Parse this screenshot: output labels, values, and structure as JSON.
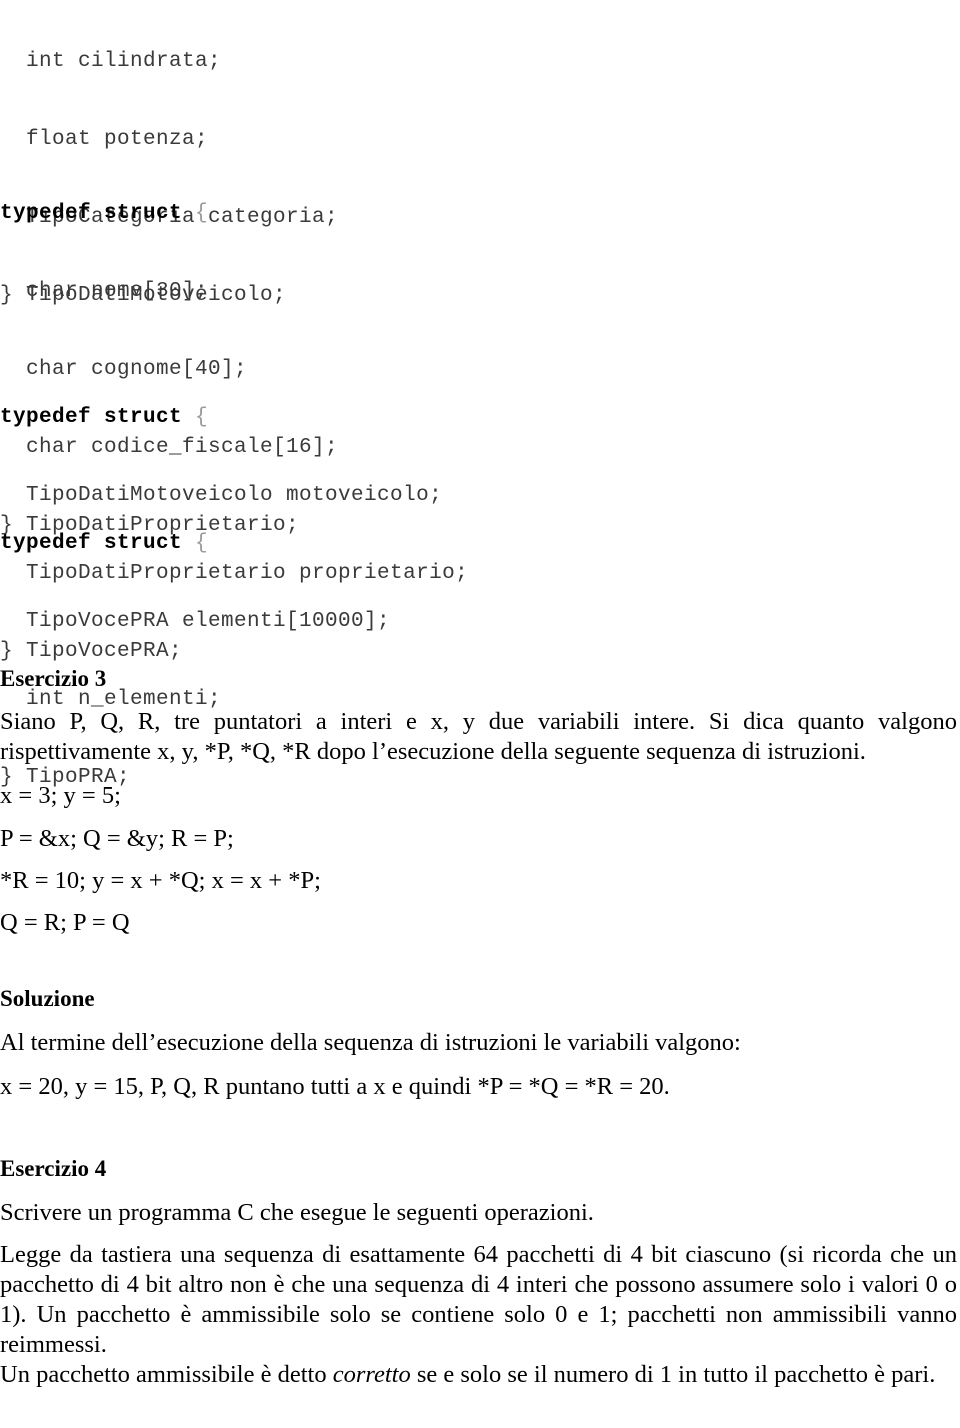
{
  "document": {
    "language": "it",
    "page_background": "#ffffff",
    "text_color": "#000000",
    "code_color": "#3a3a3a"
  },
  "code_blocks": [
    {
      "id": "code-block-1",
      "lines": [
        {
          "indent": "  ",
          "text": "int cilindrata;",
          "bold_prefix": ""
        },
        {
          "indent": "  ",
          "text": "float potenza;",
          "bold_prefix": ""
        },
        {
          "indent": "  ",
          "text": "TipoCategoria categoria;",
          "bold_prefix": ""
        },
        {
          "indent": "",
          "text": "} TipoDatiMotoveicolo;",
          "bold_prefix": ""
        }
      ]
    },
    {
      "id": "code-block-2",
      "header_keyword": "typedef struct",
      "header_brace": " {",
      "lines": [
        {
          "indent": "  ",
          "text": "char nome[30];"
        },
        {
          "indent": "  ",
          "text": "char cognome[40];"
        },
        {
          "indent": "  ",
          "text": "char codice_fiscale[16];"
        },
        {
          "indent": "",
          "text": "} TipoDatiProprietario;"
        }
      ]
    },
    {
      "id": "code-block-3",
      "header_keyword": "typedef struct",
      "header_brace": " {",
      "lines": [
        {
          "indent": "  ",
          "text": "TipoDatiMotoveicolo motoveicolo;"
        },
        {
          "indent": "  ",
          "text": "TipoDatiProprietario proprietario;"
        },
        {
          "indent": "",
          "text": "} TipoVocePRA;"
        }
      ]
    },
    {
      "id": "code-block-4",
      "header_keyword": "typedef struct",
      "header_brace": " {",
      "lines": [
        {
          "indent": "  ",
          "text": "TipoVocePRA elementi[10000];"
        },
        {
          "indent": "  ",
          "text": "int n_elementi;"
        },
        {
          "indent": "",
          "text": "} TipoPRA;"
        }
      ]
    }
  ],
  "code1": {
    "line1": "  int cilindrata;",
    "line2": "  float potenza;",
    "line3": "  TipoCategoria categoria;",
    "line4": "} TipoDatiMotoveicolo;"
  },
  "code2": {
    "keyword": "typedef struct",
    "brace": " {",
    "line1": "  char nome[30];",
    "line2": "  char cognome[40];",
    "line3": "  char codice_fiscale[16];",
    "line4": "} TipoDatiProprietario;"
  },
  "code3": {
    "keyword": "typedef struct",
    "brace": " {",
    "line1": "  TipoDatiMotoveicolo motoveicolo;",
    "line2": "  TipoDatiProprietario proprietario;",
    "line3": "} TipoVocePRA;"
  },
  "code4": {
    "keyword": "typedef struct",
    "brace": " {",
    "line1": "  TipoVocePRA elementi[10000];",
    "line2": "  int n_elementi;",
    "line3": "} TipoPRA;"
  },
  "esercizio3": {
    "heading": "Esercizio 3",
    "body": "Siano P, Q, R, tre puntatori a interi e x, y due variabili intere. Si dica quanto valgono rispettivamente x, y, *P, *Q, *R dopo l’esecuzione della seguente sequenza di istruzioni.",
    "instructions": [
      "x = 3; y = 5;",
      "P = &x; Q = &y; R = P;",
      "*R = 10; y = x + *Q; x = x + *P;",
      "Q = R; P = Q"
    ],
    "instr_1": "x = 3; y = 5;",
    "instr_2": "P = &x; Q = &y; R = P;",
    "instr_3": "*R = 10; y = x + *Q; x = x + *P;",
    "instr_4": "Q = R; P = Q"
  },
  "soluzione": {
    "heading": "Soluzione",
    "line_1": "Al termine dell’esecuzione della sequenza di istruzioni le variabili valgono:",
    "line_2": "x = 20, y = 15, P, Q, R puntano tutti a x e quindi *P = *Q = *R = 20."
  },
  "esercizio4": {
    "heading": "Esercizio 4",
    "intro": "Scrivere un programma C che esegue le seguenti operazioni.",
    "body": "Legge da tastiera una sequenza di esattamente 64 pacchetti di 4 bit ciascuno (si ricorda che un pacchetto di 4 bit altro non è che una sequenza di 4 interi che possono assumere solo i valori 0 o 1). Un pacchetto è ammissibile solo se contiene solo 0 e 1; pacchetti non ammissibili vanno reimmessi.",
    "tail_before_italic": "Un pacchetto ammissibile è detto ",
    "tail_italic": "corretto",
    "tail_after_italic": " se e solo se il numero di 1 in tutto il pacchetto è pari."
  }
}
